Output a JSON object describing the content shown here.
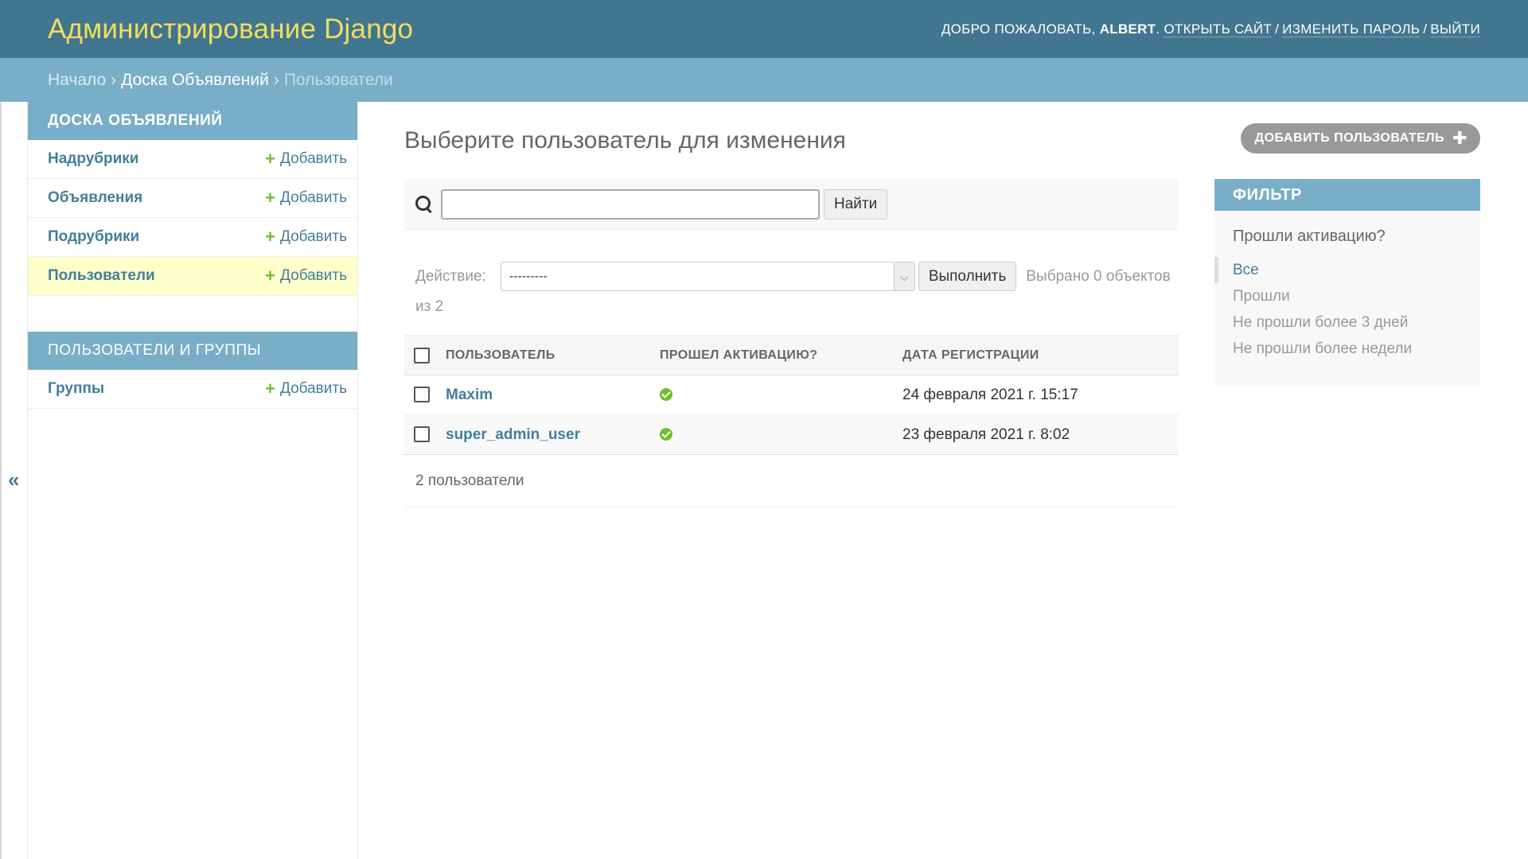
{
  "header": {
    "branding": "Администрирование Django",
    "welcome": "ДОБРО ПОЖАЛОВАТЬ,",
    "username": "ALBERT",
    "links": [
      "ОТКРЫТЬ САЙТ",
      "ИЗМЕНИТЬ ПАРОЛЬ",
      "ВЫЙТИ"
    ]
  },
  "breadcrumbs": {
    "home": "Начало",
    "app": "Доска Объявлений",
    "current": "Пользователи",
    "separator": "›"
  },
  "sidebar": {
    "toggle": "«",
    "modules": [
      {
        "caption": "ДОСКА ОБЪЯВЛЕНИЙ",
        "models": [
          {
            "name": "Надрубрики",
            "add": "Добавить"
          },
          {
            "name": "Объявления",
            "add": "Добавить"
          },
          {
            "name": "Подрубрики",
            "add": "Добавить"
          },
          {
            "name": "Пользователи",
            "add": "Добавить"
          }
        ]
      },
      {
        "caption": "ПОЛЬЗОВАТЕЛИ И ГРУППЫ",
        "models": [
          {
            "name": "Группы",
            "add": "Добавить"
          }
        ]
      }
    ],
    "current_model": "Пользователи"
  },
  "content": {
    "title": "Выберите пользователь для изменения",
    "add_button": "ДОБАВИТЬ ПОЛЬЗОВАТЕЛЬ",
    "search": {
      "value": "",
      "button": "Найти"
    },
    "actions": {
      "label": "Действие:",
      "selected_option": "---------",
      "run_button": "Выполнить",
      "counter": "Выбрано 0 объектов из 2"
    },
    "table": {
      "columns": [
        "ПОЛЬЗОВАТЕЛЬ",
        "ПРОШЕЛ АКТИВАЦИЮ?",
        "ДАТА РЕГИСТРАЦИИ"
      ],
      "rows": [
        {
          "username": "Maxim",
          "activated": true,
          "date": "24 февраля 2021 г. 15:17"
        },
        {
          "username": "super_admin_user",
          "activated": true,
          "date": "23 февраля 2021 г. 8:02"
        }
      ]
    },
    "paginator": "2 пользователи"
  },
  "filter": {
    "caption": "ФИЛЬТР",
    "question": "Прошли активацию?",
    "options": [
      "Все",
      "Прошли",
      "Не прошли более 3 дней",
      "Не прошли более недели"
    ],
    "selected": "Все"
  },
  "colors": {
    "header_bg": "#417690",
    "branding": "#f5dd5d",
    "breadcrumbs_bg": "#79aec8",
    "link": "#447e9b",
    "add_green": "#70bf2b",
    "current_row": "#ffffcc"
  }
}
